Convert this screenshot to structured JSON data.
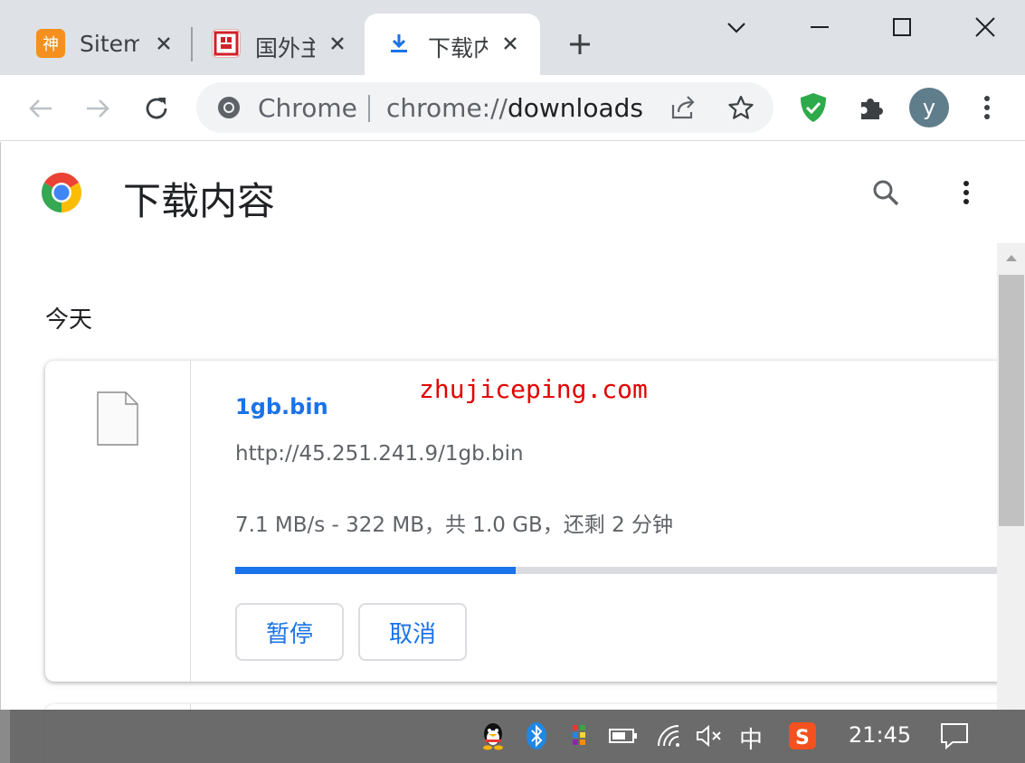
{
  "tabs": [
    {
      "title": "Sitem",
      "active": false
    },
    {
      "title": "国外主",
      "active": false
    },
    {
      "title": "下载内",
      "active": true
    }
  ],
  "omnibox": {
    "chip": "Chrome",
    "scheme": "chrome://",
    "host": "downloads"
  },
  "avatar_letter": "y",
  "page": {
    "title": "下载内容",
    "section": "今天"
  },
  "download": {
    "file_name": "1gb.bin",
    "url": "http://45.251.241.9/1gb.bin",
    "status": "7.1 MB/s - 322 MB，共 1.0 GB，还剩 2 分钟",
    "progress_fraction": 0.36,
    "pause_label": "暂停",
    "cancel_label": "取消"
  },
  "watermark": "zhujiceping.com",
  "taskbar": {
    "ime": "中",
    "time": "21:45"
  },
  "colors": {
    "accent": "#1a73e8",
    "tabstrip": "#dee1e6",
    "watermark": "#e30000"
  },
  "icons": [
    "download-icon",
    "back-icon",
    "forward-icon",
    "reload-icon",
    "share-icon",
    "star-icon",
    "shield-icon",
    "puzzle-icon",
    "kebab-icon",
    "search-icon",
    "file-icon",
    "bluetooth-icon",
    "battery-icon",
    "wifi-icon",
    "mute-icon",
    "notification-icon"
  ]
}
